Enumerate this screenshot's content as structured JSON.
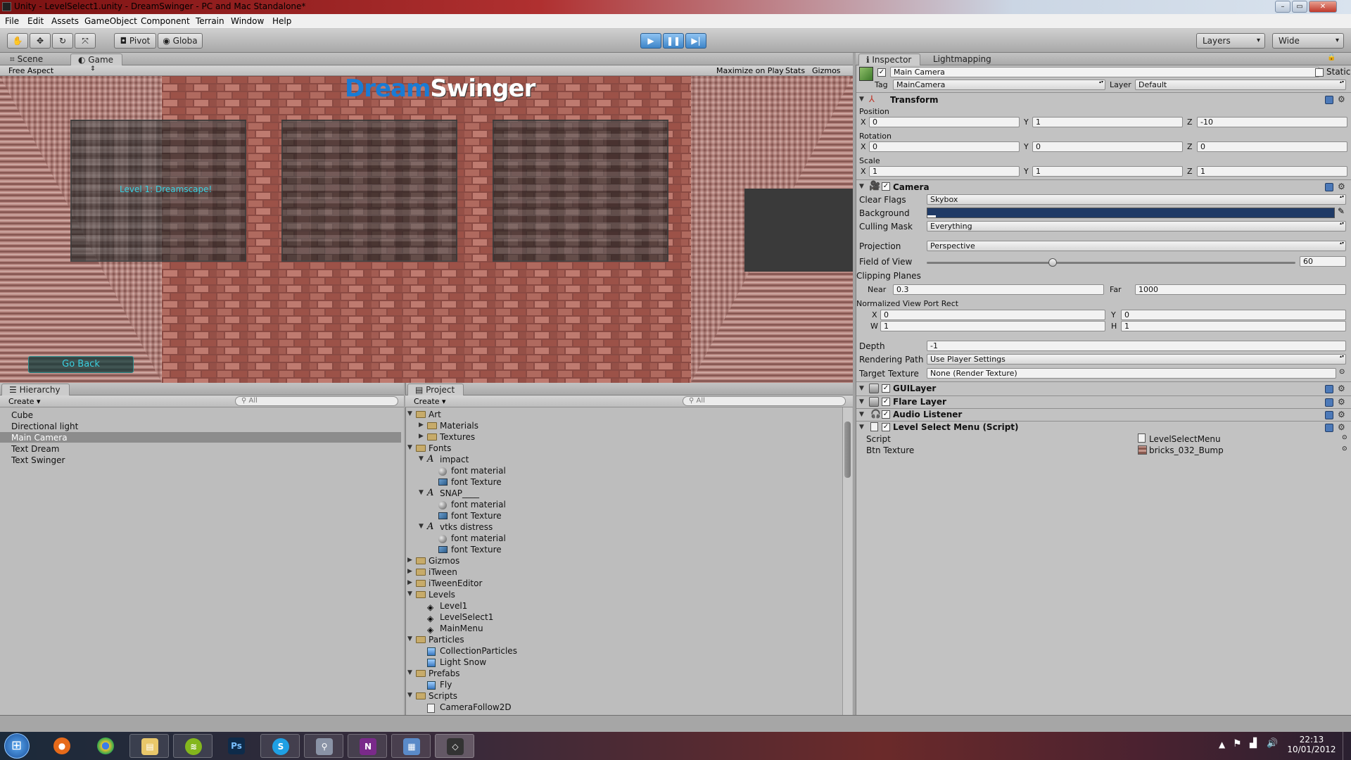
{
  "window": {
    "title": "Unity - LevelSelect1.unity - DreamSwinger - PC and Mac Standalone*",
    "controls": {
      "minimize": "–",
      "maximize": "▭",
      "close": "✕"
    }
  },
  "menu": [
    "File",
    "Edit",
    "Assets",
    "GameObject",
    "Component",
    "Terrain",
    "Window",
    "Help"
  ],
  "toolbar": {
    "tools": [
      "hand-icon",
      "move-icon",
      "rotate-icon",
      "scale-icon"
    ],
    "pivot": "Pivot",
    "global": "Globa",
    "layers": "Layers",
    "layout": "Wide"
  },
  "viewTabs": {
    "scene": "Scene",
    "game": "Game",
    "aspect": "Free Aspect",
    "maximize": "Maximize on Play",
    "stats": "Stats",
    "gizmos": "Gizmos"
  },
  "game": {
    "logo_dream": "Dream",
    "logo_swinger": "Swinger",
    "level_label": "Level 1: Dreamscape!",
    "go_back": "Go Back"
  },
  "hierarchy": {
    "title": "Hierarchy",
    "create": "Create",
    "search": "All",
    "items": [
      "Cube",
      "Directional light",
      "Main Camera",
      "Text Dream",
      "Text Swinger"
    ],
    "selected": "Main Camera"
  },
  "project": {
    "title": "Project",
    "create": "Create",
    "search": "All",
    "items": [
      {
        "label": "Art",
        "type": "folder",
        "level": 0,
        "arrow": "down"
      },
      {
        "label": "Materials",
        "type": "folder",
        "level": 1,
        "arrow": "right"
      },
      {
        "label": "Textures",
        "type": "folder",
        "level": 1,
        "arrow": "right"
      },
      {
        "label": "Fonts",
        "type": "folder",
        "level": 0,
        "arrow": "down"
      },
      {
        "label": "impact",
        "type": "font",
        "level": 1,
        "arrow": "down"
      },
      {
        "label": "font material",
        "type": "material",
        "level": 2
      },
      {
        "label": "font Texture",
        "type": "texture",
        "level": 2
      },
      {
        "label": "SNAP____",
        "type": "font",
        "level": 1,
        "arrow": "down"
      },
      {
        "label": "font material",
        "type": "material",
        "level": 2
      },
      {
        "label": "font Texture",
        "type": "texture",
        "level": 2
      },
      {
        "label": "vtks distress",
        "type": "font",
        "level": 1,
        "arrow": "down"
      },
      {
        "label": "font material",
        "type": "material",
        "level": 2
      },
      {
        "label": "font Texture",
        "type": "texture",
        "level": 2
      },
      {
        "label": "Gizmos",
        "type": "folder",
        "level": 0,
        "arrow": "right"
      },
      {
        "label": "iTween",
        "type": "folder",
        "level": 0,
        "arrow": "right"
      },
      {
        "label": "iTweenEditor",
        "type": "folder",
        "level": 0,
        "arrow": "right"
      },
      {
        "label": "Levels",
        "type": "folder",
        "level": 0,
        "arrow": "down"
      },
      {
        "label": "Level1",
        "type": "scene",
        "level": 1
      },
      {
        "label": "LevelSelect1",
        "type": "scene",
        "level": 1
      },
      {
        "label": "MainMenu",
        "type": "scene",
        "level": 1
      },
      {
        "label": "Particles",
        "type": "folder",
        "level": 0,
        "arrow": "down"
      },
      {
        "label": "CollectionParticles",
        "type": "prefab",
        "level": 1
      },
      {
        "label": "Light Snow",
        "type": "prefab",
        "level": 1
      },
      {
        "label": "Prefabs",
        "type": "folder",
        "level": 0,
        "arrow": "down"
      },
      {
        "label": "Fly",
        "type": "prefab",
        "level": 1
      },
      {
        "label": "Scripts",
        "type": "folder",
        "level": 0,
        "arrow": "down"
      },
      {
        "label": "CameraFollow2D",
        "type": "script",
        "level": 1
      }
    ]
  },
  "inspector": {
    "tab_inspector": "Inspector",
    "tab_lightmapping": "Lightmapping",
    "object_name": "Main Camera",
    "static": "Static",
    "tag_label": "Tag",
    "tag": "MainCamera",
    "layer_label": "Layer",
    "layer": "Default",
    "transform": {
      "title": "Transform",
      "position_label": "Position",
      "rotation_label": "Rotation",
      "scale_label": "Scale",
      "position": {
        "x": "0",
        "y": "1",
        "z": "-10"
      },
      "rotation": {
        "x": "0",
        "y": "0",
        "z": "0"
      },
      "scale": {
        "x": "1",
        "y": "1",
        "z": "1"
      }
    },
    "camera": {
      "title": "Camera",
      "clear_flags_label": "Clear Flags",
      "clear_flags": "Skybox",
      "background_label": "Background",
      "background_color": "#1f3a66",
      "culling_mask_label": "Culling Mask",
      "culling_mask": "Everything",
      "projection_label": "Projection",
      "projection": "Perspective",
      "fov_label": "Field of View",
      "fov": "60",
      "fov_slider_fraction": 0.33,
      "clipping_label": "Clipping Planes",
      "near_label": "Near",
      "near": "0.3",
      "far_label": "Far",
      "far": "1000",
      "viewport_label": "Normalized View Port Rect",
      "viewport": {
        "x": "0",
        "y": "0",
        "w": "1",
        "h": "1"
      },
      "depth_label": "Depth",
      "depth": "-1",
      "rendering_path_label": "Rendering Path",
      "rendering_path": "Use Player Settings",
      "target_texture_label": "Target Texture",
      "target_texture": "None (Render Texture)"
    },
    "components": [
      "GUILayer",
      "Flare Layer",
      "Audio Listener",
      "Level Select Menu (Script)"
    ],
    "script": {
      "script_label": "Script",
      "script_value": "LevelSelectMenu",
      "btn_texture_label": "Btn Texture",
      "btn_texture_value": "bricks_032_Bump"
    }
  },
  "taskbar": {
    "apps": [
      "Start",
      "Firefox",
      "Chrome",
      "Explorer",
      "Spotify",
      "Photoshop",
      "Skype",
      "Tool",
      "OneNote",
      "Panel",
      "Unity"
    ],
    "time": "22:13",
    "date": "10/01/2012"
  }
}
